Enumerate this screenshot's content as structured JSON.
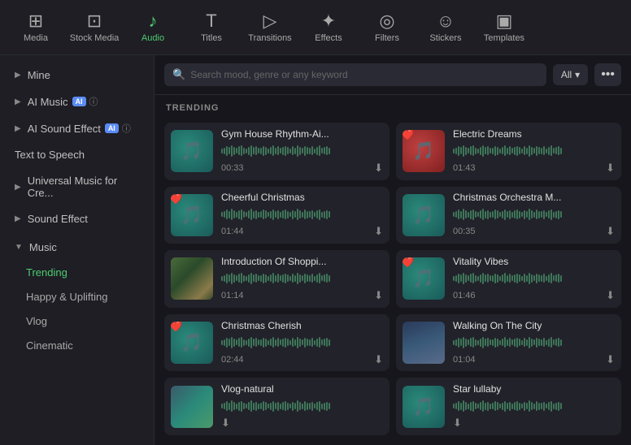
{
  "topNav": {
    "items": [
      {
        "id": "media",
        "label": "Media",
        "icon": "⊞",
        "active": false
      },
      {
        "id": "stock-media",
        "label": "Stock Media",
        "icon": "⊡",
        "active": false
      },
      {
        "id": "audio",
        "label": "Audio",
        "icon": "♪",
        "active": true
      },
      {
        "id": "titles",
        "label": "Titles",
        "icon": "T",
        "active": false
      },
      {
        "id": "transitions",
        "label": "Transitions",
        "icon": "▷",
        "active": false
      },
      {
        "id": "effects",
        "label": "Effects",
        "icon": "✦",
        "active": false
      },
      {
        "id": "filters",
        "label": "Filters",
        "icon": "◎",
        "active": false
      },
      {
        "id": "stickers",
        "label": "Stickers",
        "icon": "☺",
        "active": false
      },
      {
        "id": "templates",
        "label": "Templates",
        "icon": "▣",
        "active": false
      }
    ]
  },
  "sidebar": {
    "items": [
      {
        "id": "mine",
        "label": "Mine",
        "type": "chevron-right",
        "badge": null
      },
      {
        "id": "ai-music",
        "label": "AI Music",
        "type": "chevron-right",
        "badge": "AI",
        "info": true
      },
      {
        "id": "ai-sound-effect",
        "label": "AI Sound Effect",
        "type": "chevron-right",
        "badge": "AI",
        "info": true
      },
      {
        "id": "text-to-speech",
        "label": "Text to Speech",
        "type": "plain"
      },
      {
        "id": "universal-music",
        "label": "Universal Music for Cre...",
        "type": "chevron-right",
        "badge": null
      },
      {
        "id": "sound-effect",
        "label": "Sound Effect",
        "type": "chevron-right",
        "badge": null
      }
    ],
    "musicSection": {
      "label": "Music",
      "subItems": [
        {
          "id": "trending",
          "label": "Trending",
          "active": true
        },
        {
          "id": "happy-uplifting",
          "label": "Happy & Uplifting",
          "active": false
        },
        {
          "id": "vlog",
          "label": "Vlog",
          "active": false
        },
        {
          "id": "cinematic",
          "label": "Cinematic",
          "active": false
        }
      ]
    }
  },
  "searchBar": {
    "placeholder": "Search mood, genre or any keyword",
    "filterLabel": "All",
    "moreIcon": "•••"
  },
  "content": {
    "trendingLabel": "TRENDING",
    "cards": [
      {
        "id": "gym-house",
        "title": "Gym House Rhythm-Ai...",
        "duration": "00:33",
        "thumbType": "icon",
        "thumbColor1": "#2a8a7a",
        "thumbColor2": "#1a5a5a",
        "heart": false
      },
      {
        "id": "electric-dreams",
        "title": "Electric Dreams",
        "duration": "01:43",
        "thumbType": "icon",
        "thumbColor1": "#c04040",
        "thumbColor2": "#802020",
        "heart": true
      },
      {
        "id": "cheerful-christmas",
        "title": "Cheerful Christmas",
        "duration": "01:44",
        "thumbType": "icon",
        "thumbColor1": "#2a8a7a",
        "thumbColor2": "#1a5a5a",
        "heart": true
      },
      {
        "id": "christmas-orchestra",
        "title": "Christmas Orchestra M...",
        "duration": "00:35",
        "thumbType": "icon",
        "thumbColor1": "#2a8a7a",
        "thumbColor2": "#1a5a5a",
        "heart": false
      },
      {
        "id": "introduction-shopping",
        "title": "Introduction Of Shoppi...",
        "duration": "01:14",
        "thumbType": "photo",
        "photoStyle": "background: linear-gradient(135deg, #4a6a3a 0%, #2a4a2a 40%, #8a7a4a 80%, #3a4a2a 100%);",
        "heart": false
      },
      {
        "id": "vitality-vibes",
        "title": "Vitality Vibes",
        "duration": "01:46",
        "thumbType": "icon",
        "thumbColor1": "#2a8a7a",
        "thumbColor2": "#1a5a5a",
        "heart": true
      },
      {
        "id": "christmas-cherish",
        "title": "Christmas Cherish",
        "duration": "02:44",
        "thumbType": "icon",
        "thumbColor1": "#2a8a7a",
        "thumbColor2": "#1a5a5a",
        "heart": true
      },
      {
        "id": "walking-on-the-city",
        "title": "Walking On The City",
        "duration": "01:04",
        "thumbType": "photo",
        "photoStyle": "background: linear-gradient(160deg, #2a3a5a 0%, #3a5a7a 50%, #5a6a8a 100%);",
        "heart": false
      },
      {
        "id": "vlog-natural",
        "title": "Vlog-natural",
        "duration": "",
        "thumbType": "photo",
        "photoStyle": "background: linear-gradient(135deg, #3a5a6a 0%, #2a8a7a 50%, #4a9a6a 100%);",
        "heart": false
      },
      {
        "id": "star-lullaby",
        "title": "Star lullaby",
        "duration": "",
        "thumbType": "icon",
        "thumbColor1": "#2a8a7a",
        "thumbColor2": "#1a5a5a",
        "heart": false
      }
    ]
  }
}
